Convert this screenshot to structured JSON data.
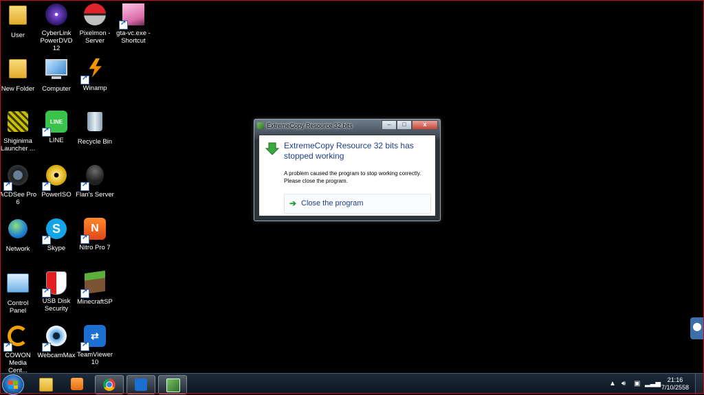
{
  "desktop": {
    "icons": [
      {
        "label": "User"
      },
      {
        "label": "CyberLink PowerDVD 12"
      },
      {
        "label": "Pixelmon - Server"
      },
      {
        "label": "gta-vc.exe - Shortcut"
      },
      {
        "label": "New Folder"
      },
      {
        "label": "Computer"
      },
      {
        "label": "Winamp"
      },
      {
        "label": "Shiginima Launcher ..."
      },
      {
        "label": "LINE"
      },
      {
        "label": "Recycle Bin"
      },
      {
        "label": "ACDSee Pro 6"
      },
      {
        "label": "PowerISO"
      },
      {
        "label": "Flan's Server"
      },
      {
        "label": "Network"
      },
      {
        "label": "Skype"
      },
      {
        "label": "Nitro Pro 7"
      },
      {
        "label": "Control Panel"
      },
      {
        "label": "USB Disk Security"
      },
      {
        "label": "MinecraftSP"
      },
      {
        "label": "COWON Media Cent..."
      },
      {
        "label": "WebcamMax"
      },
      {
        "label": "TeamViewer 10"
      }
    ]
  },
  "dialog": {
    "title": "ExtremeCopy Resource 32 bits",
    "heading": "ExtremeCopy Resource 32 bits has stopped working",
    "message": "A problem caused the program to stop working correctly. Please close the program.",
    "action_label": "Close the program",
    "minimize": "–",
    "maximize": "□",
    "close": "x"
  },
  "taskbar": {
    "clock_time": "21:16",
    "clock_date": "7/10/2558",
    "tray_up": "▲"
  },
  "colors": {
    "border_accent": "#c0101a",
    "dialog_heading": "#1e3f8c",
    "action_arrow": "#1e9e2a"
  }
}
